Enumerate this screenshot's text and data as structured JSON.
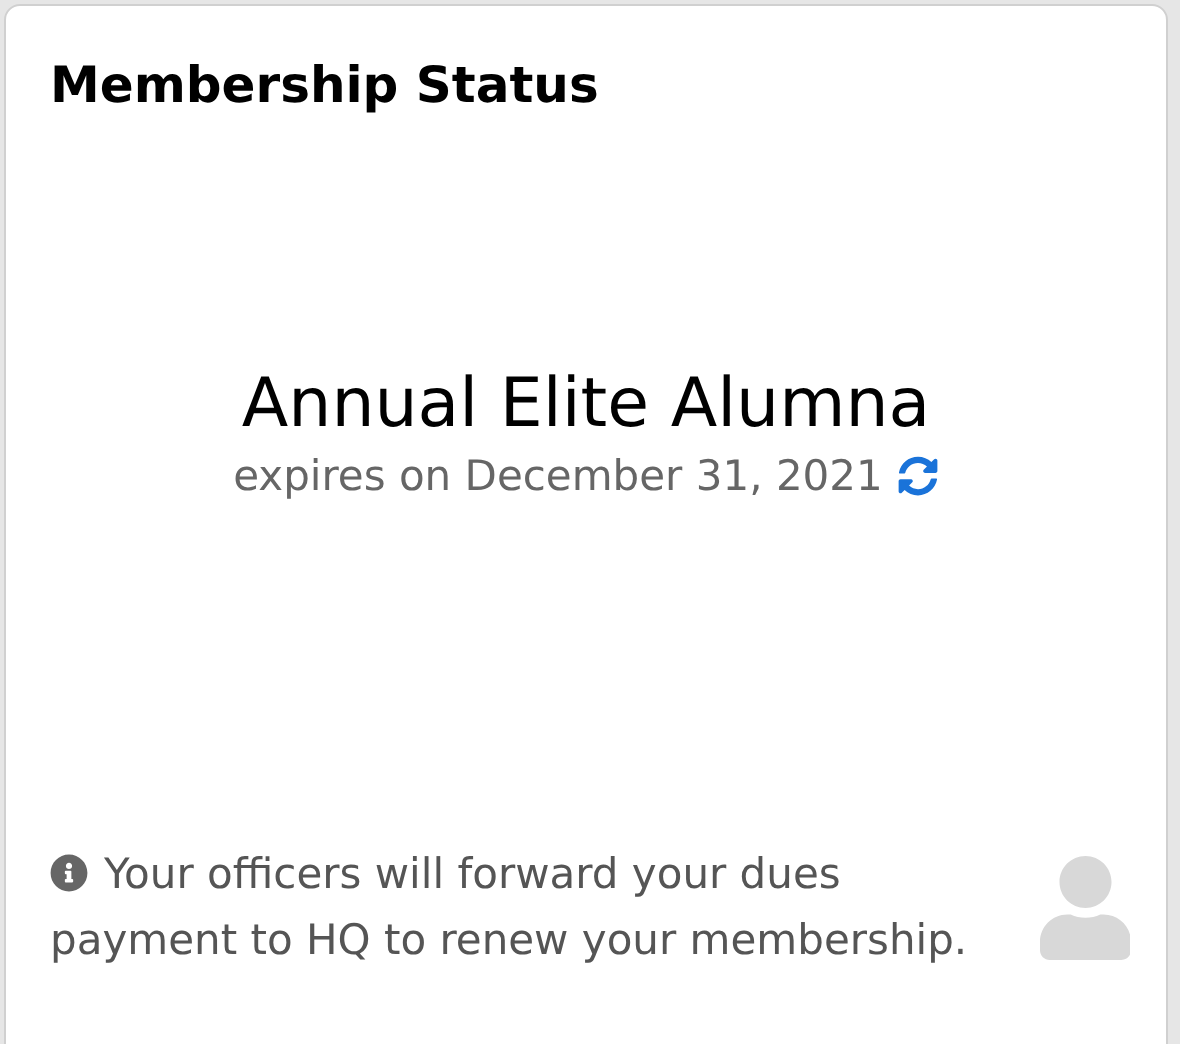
{
  "card": {
    "title": "Membership Status"
  },
  "membership": {
    "type": "Annual Elite Alumna",
    "expiry": "expires on December 31, 2021"
  },
  "note": {
    "text": "Your officers will forward your dues payment to HQ to renew your membership."
  }
}
